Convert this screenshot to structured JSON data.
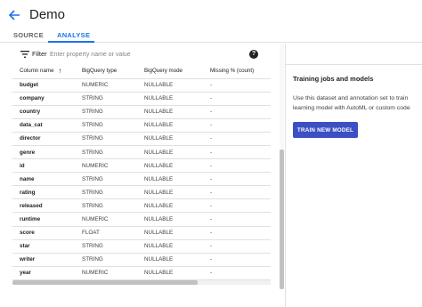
{
  "header": {
    "title": "Demo",
    "back_icon": "arrow-left-icon"
  },
  "tabs": [
    {
      "label": "SOURCE",
      "active": false
    },
    {
      "label": "ANALYSE",
      "active": true
    }
  ],
  "filter": {
    "label": "Filter",
    "placeholder": "Enter property name or value",
    "value": ""
  },
  "table": {
    "headers": [
      "Column name",
      "BigQuery type",
      "BigQuery mode",
      "Missing % (count)"
    ],
    "sort_arrow": "↑",
    "rows": [
      {
        "name": "budget",
        "type": "NUMERIC",
        "mode": "NULLABLE",
        "missing": "-"
      },
      {
        "name": "company",
        "type": "STRING",
        "mode": "NULLABLE",
        "missing": "-"
      },
      {
        "name": "country",
        "type": "STRING",
        "mode": "NULLABLE",
        "missing": "-"
      },
      {
        "name": "data_cat",
        "type": "STRING",
        "mode": "NULLABLE",
        "missing": "-"
      },
      {
        "name": "director",
        "type": "STRING",
        "mode": "NULLABLE",
        "missing": "-"
      },
      {
        "name": "genre",
        "type": "STRING",
        "mode": "NULLABLE",
        "missing": "-"
      },
      {
        "name": "id",
        "type": "NUMERIC",
        "mode": "NULLABLE",
        "missing": "-"
      },
      {
        "name": "name",
        "type": "STRING",
        "mode": "NULLABLE",
        "missing": "-"
      },
      {
        "name": "rating",
        "type": "STRING",
        "mode": "NULLABLE",
        "missing": "-"
      },
      {
        "name": "released",
        "type": "STRING",
        "mode": "NULLABLE",
        "missing": "-"
      },
      {
        "name": "runtime",
        "type": "NUMERIC",
        "mode": "NULLABLE",
        "missing": "-"
      },
      {
        "name": "score",
        "type": "FLOAT",
        "mode": "NULLABLE",
        "missing": "-"
      },
      {
        "name": "star",
        "type": "STRING",
        "mode": "NULLABLE",
        "missing": "-"
      },
      {
        "name": "writer",
        "type": "STRING",
        "mode": "NULLABLE",
        "missing": "-"
      },
      {
        "name": "year",
        "type": "NUMERIC",
        "mode": "NULLABLE",
        "missing": "-"
      }
    ]
  },
  "training": {
    "title": "Training jobs and models",
    "desc_line1": "Use this dataset and annotation set to train",
    "desc_line2": "learning model with AutoML or custom code",
    "button_label": "TRAIN NEW MODEL"
  },
  "colors": {
    "accent": "#1a73e8",
    "button": "#3c4fc4"
  }
}
